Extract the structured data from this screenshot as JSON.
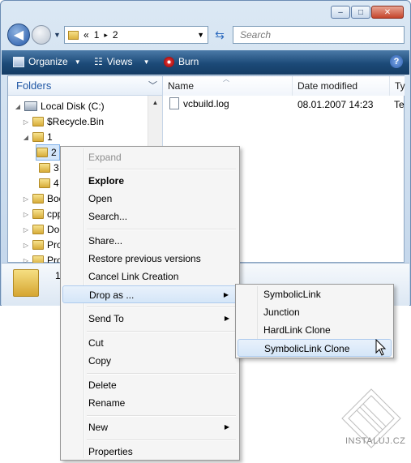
{
  "window": {
    "caption_buttons": {
      "minimize": "–",
      "maximize": "□",
      "close": "✕"
    },
    "breadcrumb": {
      "overflow": "«",
      "parts": [
        "1",
        "2"
      ],
      "separator": "▸"
    },
    "search_placeholder": "Search"
  },
  "toolbar": {
    "organize": "Organize",
    "views": "Views",
    "burn": "Burn",
    "help": "?"
  },
  "folders_pane": {
    "title": "Folders",
    "items": [
      {
        "label": "Local Disk (C:)"
      },
      {
        "label": "$Recycle.Bin"
      },
      {
        "label": "1"
      },
      {
        "label": "2"
      },
      {
        "label": "3"
      },
      {
        "label": "4"
      },
      {
        "label": "Boo"
      },
      {
        "label": "cpp"
      },
      {
        "label": "Doc"
      },
      {
        "label": "Pro"
      },
      {
        "label": "Pro"
      }
    ]
  },
  "files_pane": {
    "columns": [
      "Name",
      "Date modified",
      "Ty"
    ],
    "rows": [
      {
        "name": "vcbuild.log",
        "date": "08.01.2007 14:23",
        "type": "Te"
      }
    ]
  },
  "details_pane": {
    "name": "1"
  },
  "context_menu": {
    "items": [
      {
        "label": "Expand"
      },
      {
        "label": "Explore"
      },
      {
        "label": "Open"
      },
      {
        "label": "Search..."
      },
      {
        "label": "Share..."
      },
      {
        "label": "Restore previous versions"
      },
      {
        "label": "Cancel Link Creation"
      },
      {
        "label": "Drop as ..."
      },
      {
        "label": "Send To"
      },
      {
        "label": "Cut"
      },
      {
        "label": "Copy"
      },
      {
        "label": "Delete"
      },
      {
        "label": "Rename"
      },
      {
        "label": "New"
      },
      {
        "label": "Properties"
      }
    ]
  },
  "drop_as_submenu": {
    "items": [
      {
        "label": "SymbolicLink"
      },
      {
        "label": "Junction"
      },
      {
        "label": "HardLink Clone"
      },
      {
        "label": "SymbolicLink Clone"
      }
    ]
  },
  "watermark": "INSTALUJ.CZ"
}
